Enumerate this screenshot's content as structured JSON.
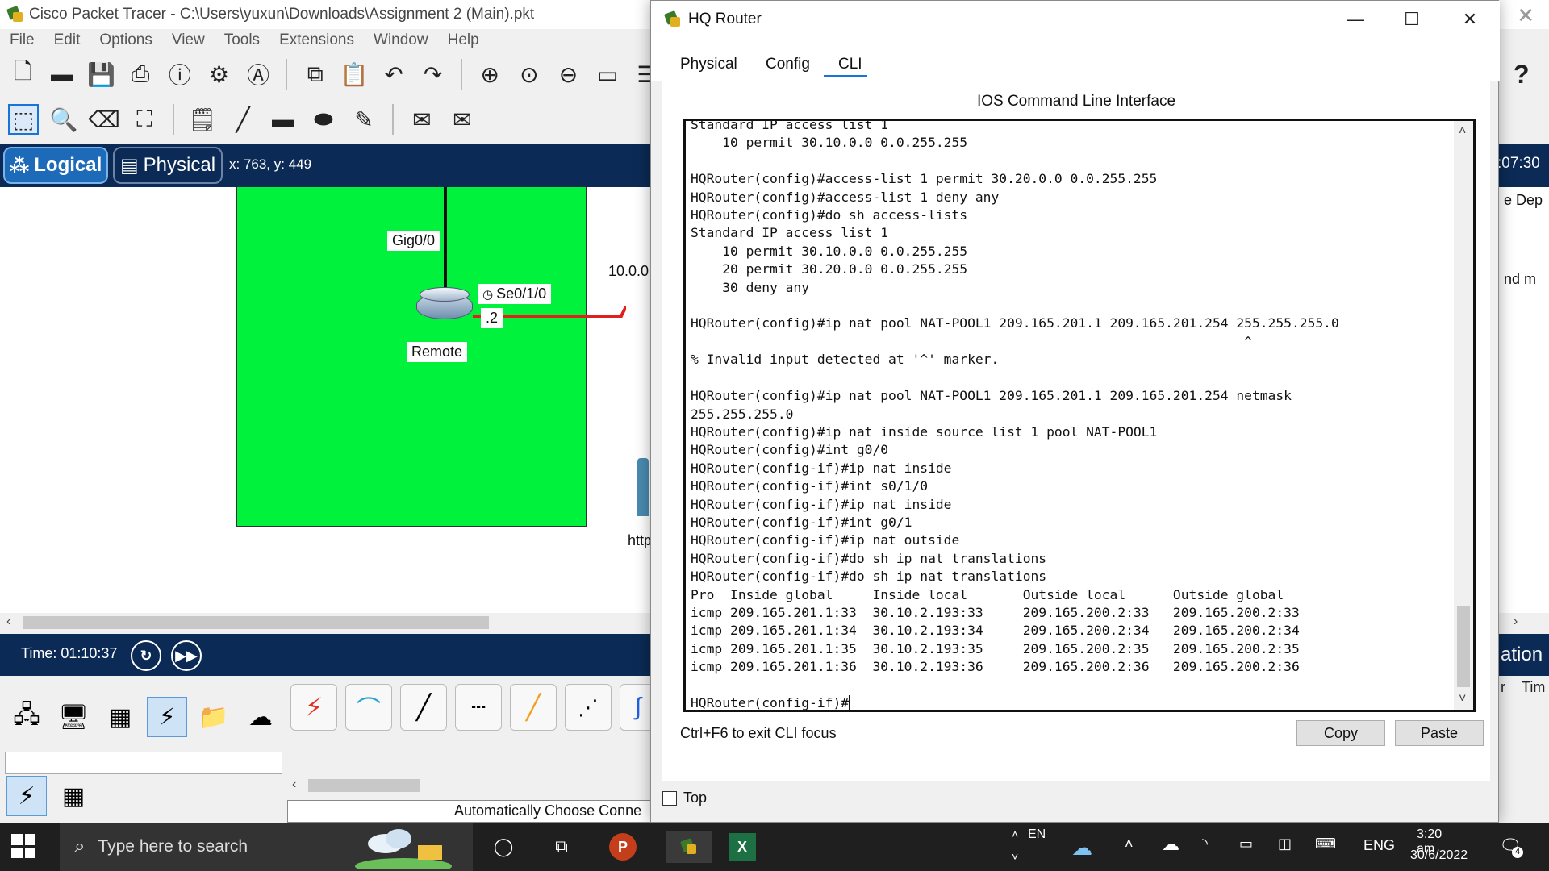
{
  "pt": {
    "title": "Cisco Packet Tracer - C:\\Users\\yuxun\\Downloads\\Assignment 2 (Main).pkt",
    "menu": [
      "File",
      "Edit",
      "Options",
      "View",
      "Tools",
      "Extensions",
      "Window",
      "Help"
    ],
    "mode_logical": "Logical",
    "mode_physical": "Physical",
    "coords": "x: 763, y: 449",
    "clock_partial": ":07:30",
    "labels": {
      "gig": "Gig0/0",
      "serial": "Se0/1/0",
      "dot2": ".2",
      "remote": "Remote",
      "net": "10.0.0",
      "http": "http",
      "dep": "e Dep",
      "ndm": "nd m"
    },
    "time": "Time: 01:10:37",
    "ation": "ation",
    "auto_choose": "Automatically Choose Conne",
    "right_cols": [
      "r",
      "Tim"
    ]
  },
  "dlg": {
    "title": "HQ Router",
    "tabs": [
      "Physical",
      "Config",
      "CLI"
    ],
    "active_tab": "CLI",
    "ios_title": "IOS Command Line Interface",
    "terminal_lines": [
      "Standard IP access list 1",
      "    10 permit 30.10.0.0 0.0.255.255",
      "",
      "HQRouter(config)#access-list 1 permit 30.20.0.0 0.0.255.255",
      "HQRouter(config)#access-list 1 deny any",
      "HQRouter(config)#do sh access-lists",
      "Standard IP access list 1",
      "    10 permit 30.10.0.0 0.0.255.255",
      "    20 permit 30.20.0.0 0.0.255.255",
      "    30 deny any",
      "",
      "HQRouter(config)#ip nat pool NAT-POOL1 209.165.201.1 209.165.201.254 255.255.255.0",
      "                                                                      ^",
      "% Invalid input detected at '^' marker.",
      "",
      "HQRouter(config)#ip nat pool NAT-POOL1 209.165.201.1 209.165.201.254 netmask",
      "255.255.255.0",
      "HQRouter(config)#ip nat inside source list 1 pool NAT-POOL1",
      "HQRouter(config)#int g0/0",
      "HQRouter(config-if)#ip nat inside",
      "HQRouter(config-if)#int s0/1/0",
      "HQRouter(config-if)#ip nat inside",
      "HQRouter(config-if)#int g0/1",
      "HQRouter(config-if)#ip nat outside",
      "HQRouter(config-if)#do sh ip nat translations",
      "HQRouter(config-if)#do sh ip nat translations",
      "Pro  Inside global     Inside local       Outside local      Outside global",
      "icmp 209.165.201.1:33  30.10.2.193:33     209.165.200.2:33   209.165.200.2:33",
      "icmp 209.165.201.1:34  30.10.2.193:34     209.165.200.2:34   209.165.200.2:34",
      "icmp 209.165.201.1:35  30.10.2.193:35     209.165.200.2:35   209.165.200.2:35",
      "icmp 209.165.201.1:36  30.10.2.193:36     209.165.200.2:36   209.165.200.2:36",
      "",
      "HQRouter(config-if)#"
    ],
    "focus_hint": "Ctrl+F6 to exit CLI focus",
    "copy": "Copy",
    "paste": "Paste",
    "top_label": "Top"
  },
  "taskbar": {
    "search_placeholder": "Type here to search",
    "lang_small": "EN",
    "lang": "ENG",
    "time": "3:20 am",
    "date": "30/6/2022",
    "notif_count": "4"
  }
}
